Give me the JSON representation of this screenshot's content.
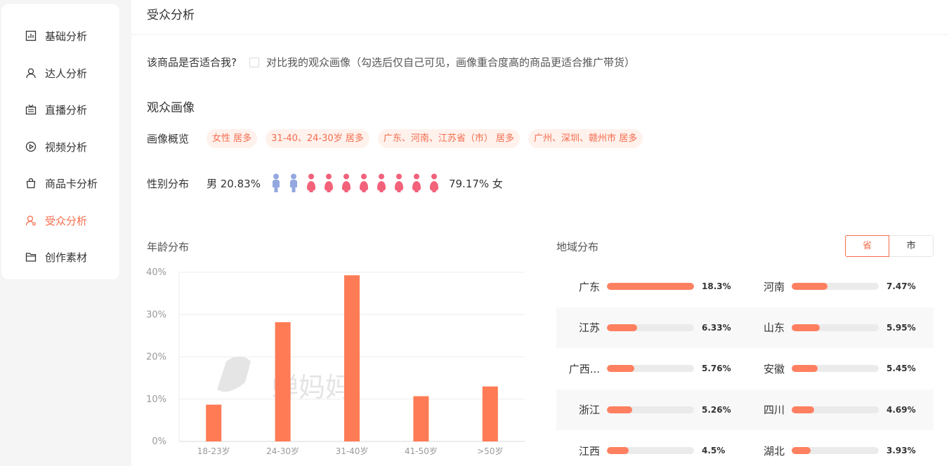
{
  "sidebar": {
    "items": [
      {
        "label": "基础分析",
        "icon": "bar-chart-icon"
      },
      {
        "label": "达人分析",
        "icon": "user-icon"
      },
      {
        "label": "直播分析",
        "icon": "live-tv-icon"
      },
      {
        "label": "视频分析",
        "icon": "play-circle-icon"
      },
      {
        "label": "商品卡分析",
        "icon": "shopping-bag-icon"
      },
      {
        "label": "受众分析",
        "icon": "audience-icon"
      },
      {
        "label": "创作素材",
        "icon": "folder-icon"
      }
    ],
    "active_index": 5
  },
  "main": {
    "title": "受众分析",
    "question": "该商品是否适合我?",
    "compare_option": "对比我的观众画像（勾选后仅自己可见，画像重合度高的商品更适合推广带货）",
    "section_title": "观众画像",
    "overview_label": "画像概览",
    "tags": [
      "女性 居多",
      "31-40、24-30岁 居多",
      "广东、河南、江苏省（市） 居多",
      "广州、深圳、赣州市 居多"
    ],
    "gender_label": "性别分布",
    "male_text": "男 20.83%",
    "female_text": "79.17% 女",
    "gender_icons": {
      "male_count": 2,
      "female_count": 8,
      "male_color": "#93a8e0",
      "female_color": "#f2627a"
    },
    "age_title": "年龄分布",
    "region_title": "地域分布",
    "region_toggle": {
      "options": [
        "省",
        "市"
      ],
      "selected": "省"
    }
  },
  "regions": [
    {
      "name": "广东",
      "value": "18.3%",
      "pct": 18.3
    },
    {
      "name": "河南",
      "value": "7.47%",
      "pct": 7.47
    },
    {
      "name": "江苏",
      "value": "6.33%",
      "pct": 6.33
    },
    {
      "name": "山东",
      "value": "5.95%",
      "pct": 5.95
    },
    {
      "name": "广西...",
      "value": "5.76%",
      "pct": 5.76
    },
    {
      "name": "安徽",
      "value": "5.45%",
      "pct": 5.45
    },
    {
      "name": "浙江",
      "value": "5.26%",
      "pct": 5.26
    },
    {
      "name": "四川",
      "value": "4.69%",
      "pct": 4.69
    },
    {
      "name": "江西",
      "value": "4.5%",
      "pct": 4.5
    },
    {
      "name": "湖北",
      "value": "3.93%",
      "pct": 3.93
    }
  ],
  "chart_data": {
    "type": "bar",
    "title": "年龄分布",
    "categories": [
      "18-23岁",
      "24-30岁",
      "31-40岁",
      "41-50岁",
      ">50岁"
    ],
    "values": [
      8.7,
      28.2,
      39.3,
      10.7,
      13.0
    ],
    "yticks": [
      "0%",
      "10%",
      "20%",
      "30%",
      "40%"
    ],
    "ylim": [
      0,
      40
    ],
    "grid": true,
    "color": "#ff7b55",
    "watermark": "蝉妈妈"
  },
  "colors": {
    "accent": "#f56d4e",
    "tag_bg": "#fff1ec",
    "bar": "#ff8060"
  }
}
